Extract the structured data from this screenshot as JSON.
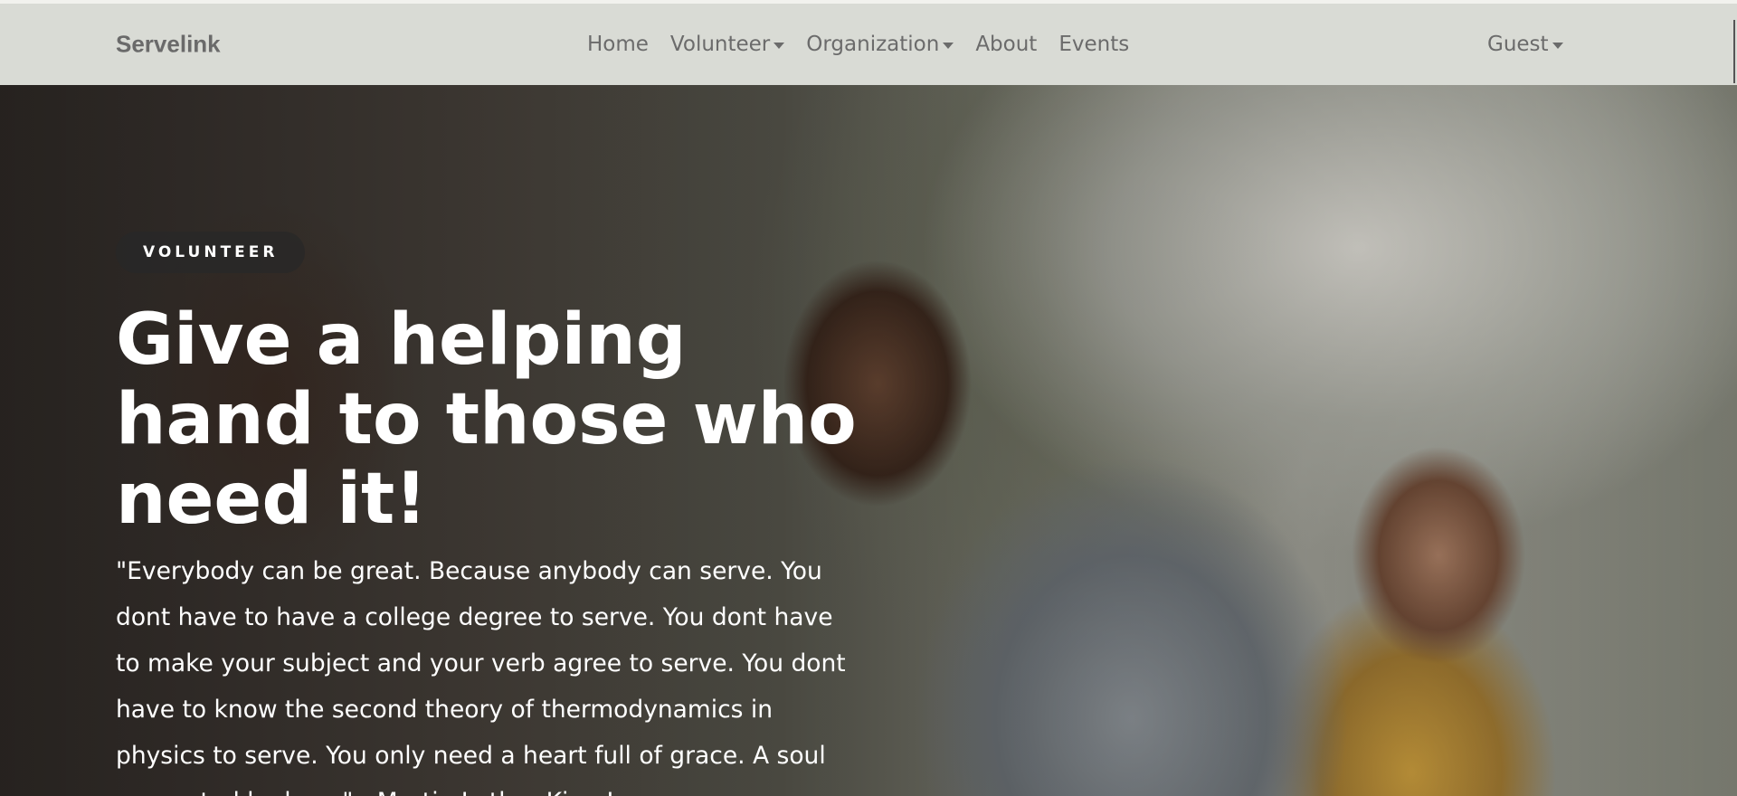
{
  "navbar": {
    "brand": "Servelink",
    "links": {
      "home": "Home",
      "volunteer": "Volunteer",
      "organization": "Organization",
      "about": "About",
      "events": "Events"
    },
    "user_menu": "Guest"
  },
  "hero": {
    "badge": "VOLUNTEER",
    "headline": "Give a helping hand to those who need it!",
    "quote": "\"Everybody can be great. Because anybody can serve. You dont have to have a college degree to serve. You dont have to make your subject and your verb agree to serve. You dont have to know the second theory of thermodynamics in physics to serve. You only need a heart full of grace. A soul generated by love.\" - Martin Luther King Jr."
  },
  "icons": {
    "dropdown": "chevron-down-icon"
  }
}
